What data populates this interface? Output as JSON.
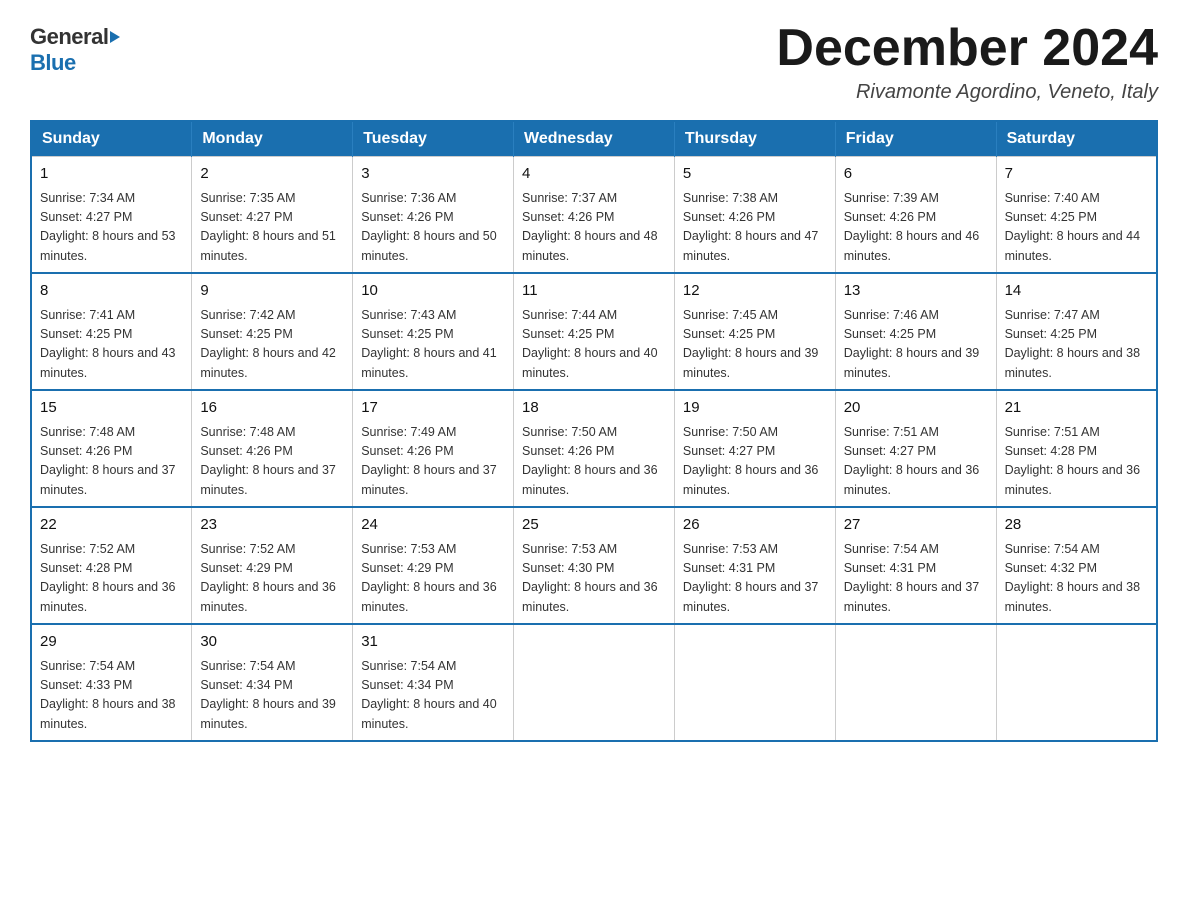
{
  "logo": {
    "general": "General",
    "blue": "Blue"
  },
  "title": "December 2024",
  "subtitle": "Rivamonte Agordino, Veneto, Italy",
  "days_of_week": [
    "Sunday",
    "Monday",
    "Tuesday",
    "Wednesday",
    "Thursday",
    "Friday",
    "Saturday"
  ],
  "weeks": [
    [
      {
        "day": "1",
        "sunrise": "7:34 AM",
        "sunset": "4:27 PM",
        "daylight": "8 hours and 53 minutes."
      },
      {
        "day": "2",
        "sunrise": "7:35 AM",
        "sunset": "4:27 PM",
        "daylight": "8 hours and 51 minutes."
      },
      {
        "day": "3",
        "sunrise": "7:36 AM",
        "sunset": "4:26 PM",
        "daylight": "8 hours and 50 minutes."
      },
      {
        "day": "4",
        "sunrise": "7:37 AM",
        "sunset": "4:26 PM",
        "daylight": "8 hours and 48 minutes."
      },
      {
        "day": "5",
        "sunrise": "7:38 AM",
        "sunset": "4:26 PM",
        "daylight": "8 hours and 47 minutes."
      },
      {
        "day": "6",
        "sunrise": "7:39 AM",
        "sunset": "4:26 PM",
        "daylight": "8 hours and 46 minutes."
      },
      {
        "day": "7",
        "sunrise": "7:40 AM",
        "sunset": "4:25 PM",
        "daylight": "8 hours and 44 minutes."
      }
    ],
    [
      {
        "day": "8",
        "sunrise": "7:41 AM",
        "sunset": "4:25 PM",
        "daylight": "8 hours and 43 minutes."
      },
      {
        "day": "9",
        "sunrise": "7:42 AM",
        "sunset": "4:25 PM",
        "daylight": "8 hours and 42 minutes."
      },
      {
        "day": "10",
        "sunrise": "7:43 AM",
        "sunset": "4:25 PM",
        "daylight": "8 hours and 41 minutes."
      },
      {
        "day": "11",
        "sunrise": "7:44 AM",
        "sunset": "4:25 PM",
        "daylight": "8 hours and 40 minutes."
      },
      {
        "day": "12",
        "sunrise": "7:45 AM",
        "sunset": "4:25 PM",
        "daylight": "8 hours and 39 minutes."
      },
      {
        "day": "13",
        "sunrise": "7:46 AM",
        "sunset": "4:25 PM",
        "daylight": "8 hours and 39 minutes."
      },
      {
        "day": "14",
        "sunrise": "7:47 AM",
        "sunset": "4:25 PM",
        "daylight": "8 hours and 38 minutes."
      }
    ],
    [
      {
        "day": "15",
        "sunrise": "7:48 AM",
        "sunset": "4:26 PM",
        "daylight": "8 hours and 37 minutes."
      },
      {
        "day": "16",
        "sunrise": "7:48 AM",
        "sunset": "4:26 PM",
        "daylight": "8 hours and 37 minutes."
      },
      {
        "day": "17",
        "sunrise": "7:49 AM",
        "sunset": "4:26 PM",
        "daylight": "8 hours and 37 minutes."
      },
      {
        "day": "18",
        "sunrise": "7:50 AM",
        "sunset": "4:26 PM",
        "daylight": "8 hours and 36 minutes."
      },
      {
        "day": "19",
        "sunrise": "7:50 AM",
        "sunset": "4:27 PM",
        "daylight": "8 hours and 36 minutes."
      },
      {
        "day": "20",
        "sunrise": "7:51 AM",
        "sunset": "4:27 PM",
        "daylight": "8 hours and 36 minutes."
      },
      {
        "day": "21",
        "sunrise": "7:51 AM",
        "sunset": "4:28 PM",
        "daylight": "8 hours and 36 minutes."
      }
    ],
    [
      {
        "day": "22",
        "sunrise": "7:52 AM",
        "sunset": "4:28 PM",
        "daylight": "8 hours and 36 minutes."
      },
      {
        "day": "23",
        "sunrise": "7:52 AM",
        "sunset": "4:29 PM",
        "daylight": "8 hours and 36 minutes."
      },
      {
        "day": "24",
        "sunrise": "7:53 AM",
        "sunset": "4:29 PM",
        "daylight": "8 hours and 36 minutes."
      },
      {
        "day": "25",
        "sunrise": "7:53 AM",
        "sunset": "4:30 PM",
        "daylight": "8 hours and 36 minutes."
      },
      {
        "day": "26",
        "sunrise": "7:53 AM",
        "sunset": "4:31 PM",
        "daylight": "8 hours and 37 minutes."
      },
      {
        "day": "27",
        "sunrise": "7:54 AM",
        "sunset": "4:31 PM",
        "daylight": "8 hours and 37 minutes."
      },
      {
        "day": "28",
        "sunrise": "7:54 AM",
        "sunset": "4:32 PM",
        "daylight": "8 hours and 38 minutes."
      }
    ],
    [
      {
        "day": "29",
        "sunrise": "7:54 AM",
        "sunset": "4:33 PM",
        "daylight": "8 hours and 38 minutes."
      },
      {
        "day": "30",
        "sunrise": "7:54 AM",
        "sunset": "4:34 PM",
        "daylight": "8 hours and 39 minutes."
      },
      {
        "day": "31",
        "sunrise": "7:54 AM",
        "sunset": "4:34 PM",
        "daylight": "8 hours and 40 minutes."
      },
      null,
      null,
      null,
      null
    ]
  ],
  "labels": {
    "sunrise_prefix": "Sunrise: ",
    "sunset_prefix": "Sunset: ",
    "daylight_prefix": "Daylight: "
  }
}
